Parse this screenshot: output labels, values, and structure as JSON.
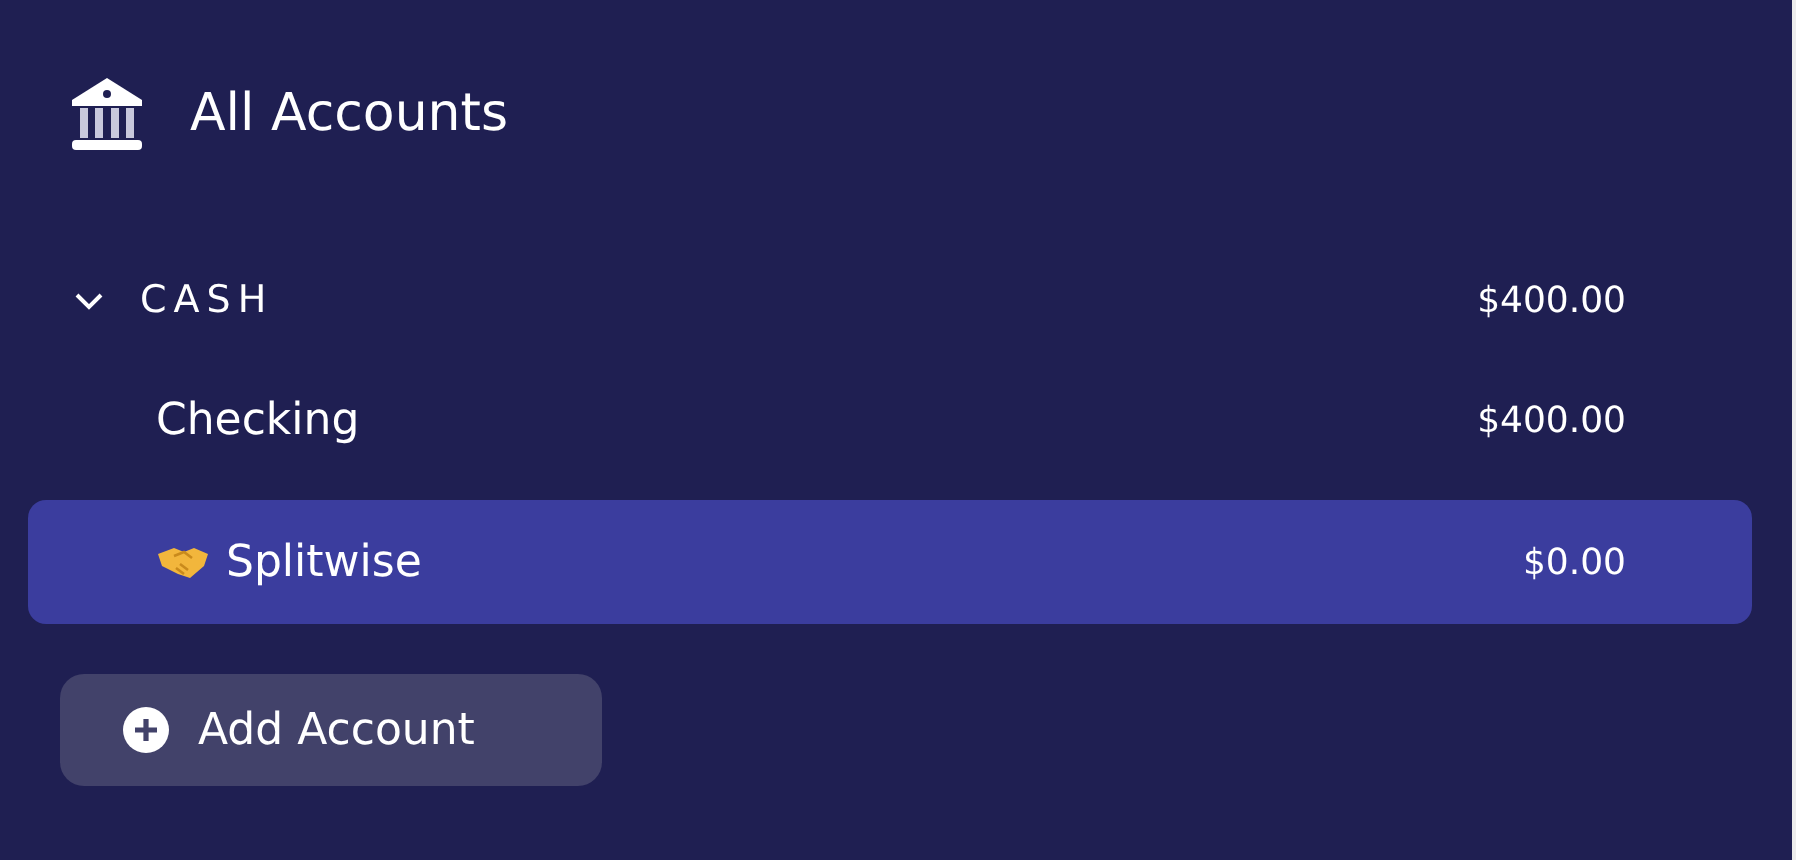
{
  "header": {
    "title": "All Accounts"
  },
  "groups": [
    {
      "name": "CASH",
      "total": "$400.00",
      "expanded": true,
      "accounts": [
        {
          "name": "Checking",
          "balance": "$400.00",
          "selected": false,
          "icon": false
        },
        {
          "name": "Splitwise",
          "balance": "$0.00",
          "selected": true,
          "icon": true
        }
      ]
    }
  ],
  "add_button": {
    "label": "Add Account"
  }
}
